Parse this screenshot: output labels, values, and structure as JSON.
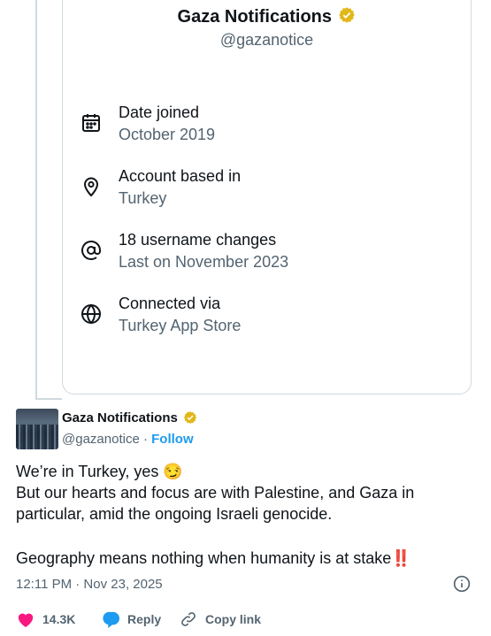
{
  "profile_card": {
    "name": "Gaza Notifications",
    "handle": "@gazanotice",
    "items": [
      {
        "icon": "calendar-icon",
        "title": "Date joined",
        "value": "October 2019"
      },
      {
        "icon": "location-pin-icon",
        "title": "Account based in",
        "value": "Turkey"
      },
      {
        "icon": "at-sign-icon",
        "title": "18 username changes",
        "value": "Last on November 2023"
      },
      {
        "icon": "globe-icon",
        "title": "Connected via",
        "value": "Turkey App Store"
      }
    ]
  },
  "tweet": {
    "author_name": "Gaza Notifications",
    "author_handle": "@gazanotice",
    "separator": "·",
    "follow_label": "Follow",
    "lines": [
      "We’re in Turkey, yes 😏",
      "But our hearts and focus are with Palestine, and Gaza in",
      "particular, amid the ongoing Israeli genocide.",
      "",
      "Geography means nothing when humanity is at stake‼️"
    ],
    "timestamp": "12:11 PM · Nov 23, 2025",
    "likes": "14.3K",
    "reply_label": "Reply",
    "copy_link_label": "Copy link"
  },
  "colors": {
    "verified_gold": "#e2b719",
    "link_blue": "#1d9bf0",
    "like_pink": "#f91880",
    "secondary_text": "#536471"
  }
}
